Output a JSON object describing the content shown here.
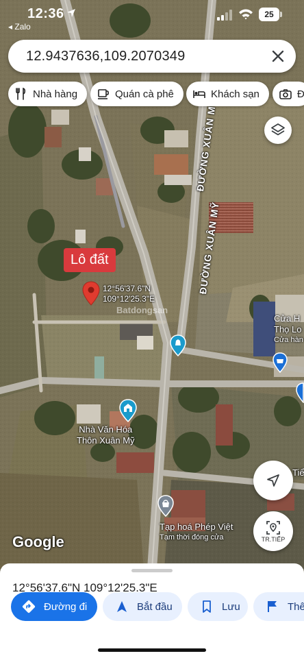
{
  "status_bar": {
    "time": "12:36",
    "back_app": "◂ Zalo",
    "battery": "25"
  },
  "search": {
    "query": "12.9437636,109.2070349"
  },
  "chips": [
    {
      "label": "Nhà hàng",
      "icon": "fork-knife-icon"
    },
    {
      "label": "Quán cà phê",
      "icon": "coffee-cup-icon"
    },
    {
      "label": "Khách sạn",
      "icon": "bed-icon"
    },
    {
      "label": "Đị",
      "icon": "camera-icon"
    }
  ],
  "map": {
    "pin_tag": "Lô đất",
    "pin_coord_lat": "12°56'37.6\"N",
    "pin_coord_lng": "109°12'25.3\"E",
    "road_labels": [
      "ĐƯỜNG XUÂN MỸ",
      "ĐƯỜNG XUÂN MỸ"
    ],
    "poi_culture_line1": "Nhà Văn Hóa",
    "poi_culture_line2": "Thôn Xuân Mỹ",
    "poi_store_name": "Tạp hoá Phép Việt",
    "poi_store_status": "Tạm thời đóng cửa",
    "poi_right_line1": "Cửa H",
    "poi_right_line2": "Thọ Lo",
    "poi_right_line3": "Cửa hàn",
    "poi_tie": "Tiể",
    "watermark": "Batdongsan",
    "attribution": "Google",
    "nav_button_label": "TR.TIẾP",
    "colors": {
      "pin": "#e03b2f",
      "poi_culture": "#1a9bcc",
      "poi_store": "#7b8794"
    }
  },
  "sheet": {
    "coordinates": "12°56'37.6\"N 109°12'25.3\"E",
    "actions": [
      {
        "label": "Đường đi",
        "icon": "directions-icon"
      },
      {
        "label": "Bắt đầu",
        "icon": "navigation-arrow-icon"
      },
      {
        "label": "Lưu",
        "icon": "bookmark-icon"
      },
      {
        "label": "Thê",
        "icon": "flag-icon"
      }
    ],
    "colors": {
      "primary": "#1a73e8",
      "secondary_bg": "#e8f0fe"
    }
  }
}
